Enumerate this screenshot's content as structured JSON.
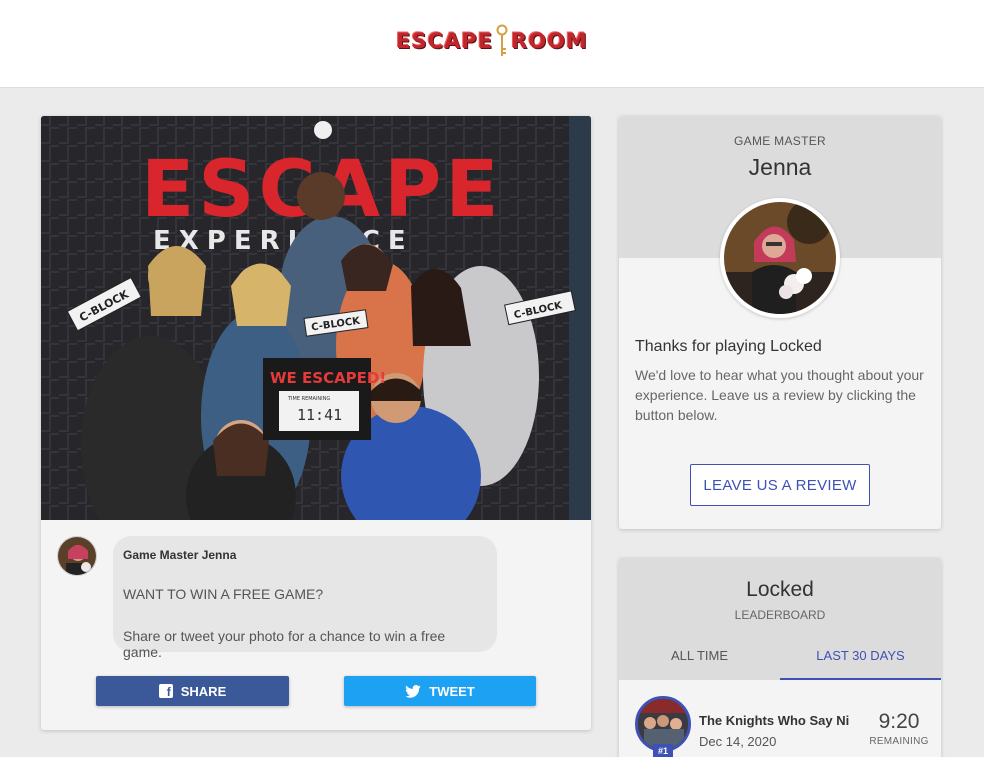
{
  "header": {
    "logo_text_left": "ESCAPE",
    "logo_text_right": "ROOM"
  },
  "photo_card": {
    "photo_sign_text": "ESCAPE",
    "photo_sign_sub": "EXPERIENCE",
    "held_sign_text": "WE ESCAPED!",
    "held_sign_time_label": "TIME REMAINING",
    "held_sign_time": "11:41",
    "c_block_text": "C-BLOCK",
    "message": {
      "author": "Game Master Jenna",
      "headline": "WANT TO WIN A FREE GAME?",
      "body": "Share or tweet your photo for a chance to win a free game."
    },
    "share_label": "SHARE",
    "tweet_label": "TWEET"
  },
  "game_master": {
    "label": "GAME MASTER",
    "name": "Jenna",
    "thanks": "Thanks for playing Locked",
    "body": "We'd love to hear what you thought about your experience. Leave us a review by clicking the button below.",
    "review_button": "LEAVE US A REVIEW"
  },
  "leaderboard": {
    "title": "Locked",
    "subtitle": "LEADERBOARD",
    "tabs": [
      {
        "label": "ALL TIME",
        "active": false
      },
      {
        "label": "LAST 30 DAYS",
        "active": true
      }
    ],
    "entries": [
      {
        "rank": "#1",
        "team": "The Knights Who Say Ni",
        "date": "Dec 14, 2020",
        "time": "9:20",
        "remaining_label": "REMAINING"
      }
    ]
  },
  "colors": {
    "accent": "#3f51b5",
    "facebook": "#3b5998",
    "twitter": "#1da1f2",
    "logo_red": "#c0272d"
  }
}
